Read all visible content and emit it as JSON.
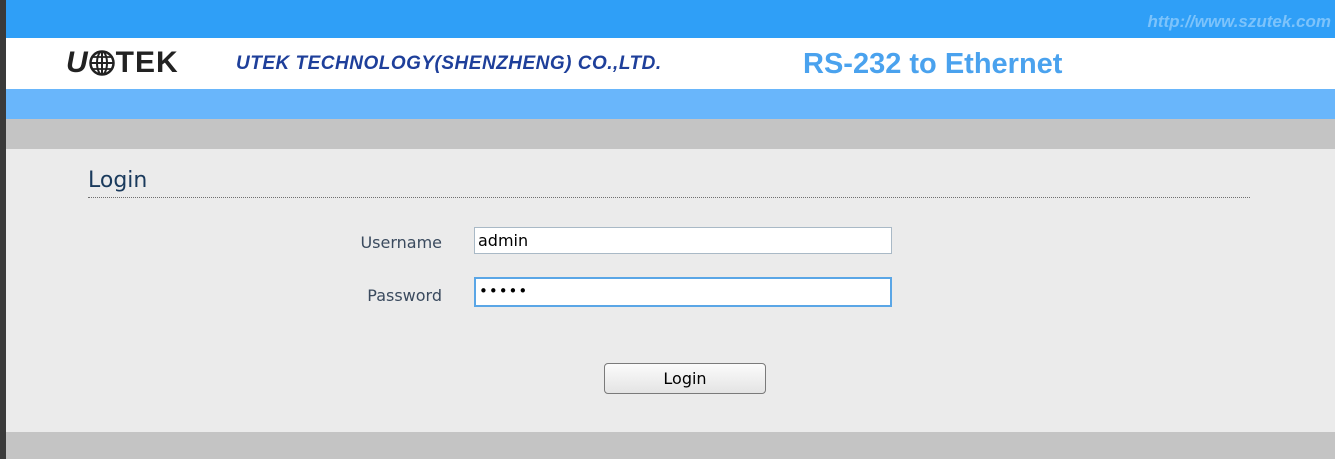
{
  "header": {
    "url": "http://www.szutek.com",
    "logo_u": "U",
    "logo_rest": "TEK",
    "company": "UTEK TECHNOLOGY(SHENZHENG) CO.,LTD.",
    "product": "RS-232 to Ethernet"
  },
  "login": {
    "title": "Login",
    "username_label": "Username",
    "username_value": "admin",
    "password_label": "Password",
    "password_value": "•••••",
    "button_label": "Login"
  },
  "colors": {
    "top_bar": "#2f9ff7",
    "blue_band": "#69b6fb",
    "gray_band": "#c4c4c4",
    "content_bg": "#ebebeb",
    "product_text": "#4aa2ee",
    "company_text": "#1e3f9a"
  },
  "icons": {
    "logo_globe": "globe-icon"
  }
}
